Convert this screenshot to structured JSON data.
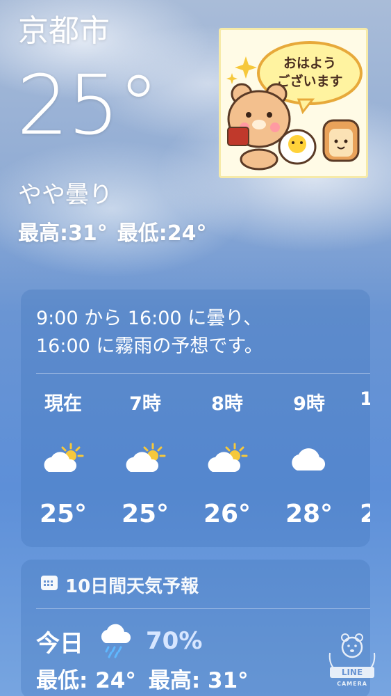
{
  "location": "京都市",
  "current_temp": "25°",
  "condition": "やや曇り",
  "high": "最高:31°",
  "low": "最低:24°",
  "sticker": {
    "text_line1": "おはよう",
    "text_line2": "ございます"
  },
  "hourly": {
    "summary_line1": "9:00 から 16:00 に曇り、",
    "summary_line2": "16:00 に霧雨の予想です。",
    "items": [
      {
        "label": "現在",
        "icon": "partly-cloudy-sun-icon",
        "temp": "25°"
      },
      {
        "label": "7時",
        "icon": "partly-cloudy-sun-icon",
        "temp": "25°"
      },
      {
        "label": "8時",
        "icon": "partly-cloudy-sun-icon",
        "temp": "26°"
      },
      {
        "label": "9時",
        "icon": "cloud-icon",
        "temp": "28°"
      },
      {
        "label": "1",
        "icon": "",
        "temp": "2"
      }
    ]
  },
  "daily": {
    "header": "10日間天気予報",
    "today": {
      "label": "今日",
      "icon": "cloud-rain-icon",
      "precip": "70%",
      "low": "最低: 24°",
      "high": "最高: 31°"
    }
  },
  "watermark": {
    "line1": "LINE",
    "line2": "CAMERA"
  },
  "colors": {
    "sun": "#f6c83b",
    "precip": "#d7e6ff",
    "rain": "#5fb8ff"
  }
}
